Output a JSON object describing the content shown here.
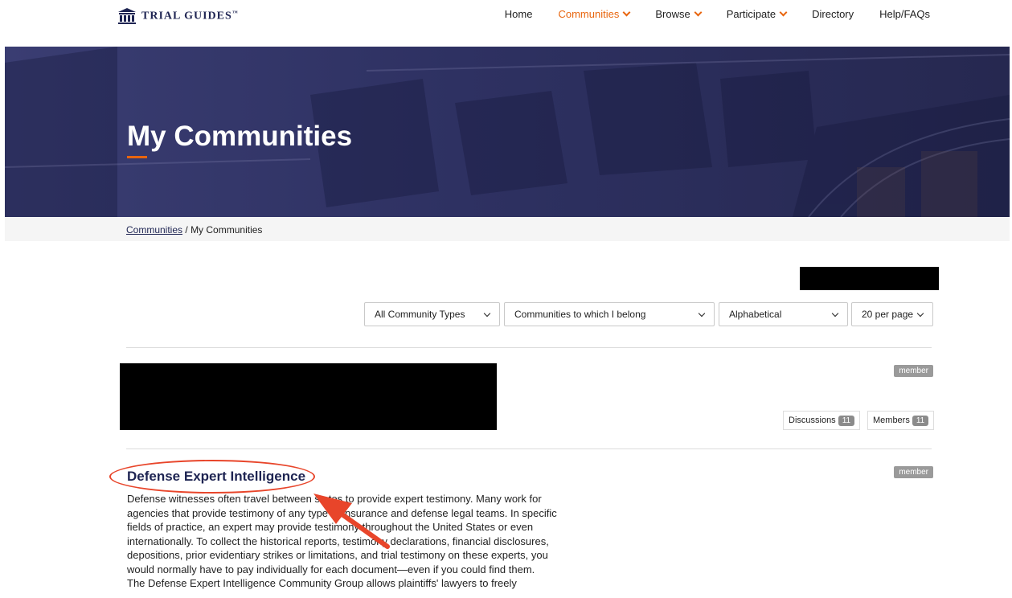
{
  "header": {
    "logo_text": "TRIAL GUIDES",
    "logo_tm": "™",
    "nav": [
      {
        "label": "Home"
      },
      {
        "label": "Communities"
      },
      {
        "label": "Browse"
      },
      {
        "label": "Participate"
      },
      {
        "label": "Directory"
      },
      {
        "label": "Help/FAQs"
      }
    ]
  },
  "hero": {
    "title": "My Communities"
  },
  "breadcrumb": {
    "parent": "Communities",
    "separator": "/",
    "current": "My Communities"
  },
  "filters": {
    "type": "All Community Types",
    "membership": "Communities to which I belong",
    "sort": "Alphabetical",
    "per_page": "20 per page"
  },
  "communities": [
    {
      "badge": "member",
      "discussions_label": "Discussions",
      "discussions_count": "11",
      "members_label": "Members",
      "members_count": "11"
    },
    {
      "title": "Defense Expert Intelligence",
      "badge": "member",
      "description_lines": [
        "Defense witnesses often travel between states to provide expert testimony. Many work for",
        "agencies that provide testimony of any type to insurance and defense legal teams. In specific",
        "fields of practice, an expert may provide testimony throughout the United States or even",
        "internationally. To collect the historical reports, testimony declarations, financial disclosures,",
        "depositions, prior evidentiary strikes or limitations, and trial testimony on these experts, you",
        "would normally have to pay individually for each document—even if you could find them.",
        "The Defense Expert Intelligence Community Group allows plaintiffs' lawyers to freely"
      ]
    }
  ],
  "colors": {
    "accent": "#e8650e",
    "brand_navy": "#1e2452",
    "annotation_red": "#e8452a"
  }
}
